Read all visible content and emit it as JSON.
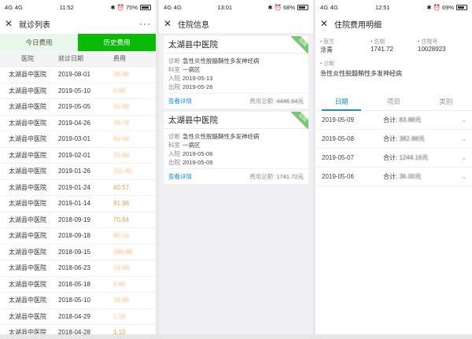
{
  "status_bars": [
    {
      "signal": "4G 4G",
      "time": "11:52",
      "battery": "75%",
      "battery_level": 0.75
    },
    {
      "signal": "4G 4G",
      "time": "13:01",
      "battery": "68%",
      "battery_level": 0.68
    },
    {
      "signal": "4G 4G",
      "time": "12:51",
      "battery": "69%",
      "battery_level": 0.69
    }
  ],
  "panel1": {
    "title": "就诊列表",
    "more": "···",
    "tabs": [
      "今日费用",
      "历史费用"
    ],
    "columns": [
      "医院",
      "就诊日期",
      "费用"
    ],
    "rows": [
      {
        "hospital": "太湖县中医院",
        "date": "2019-08-01",
        "fee": "28.30",
        "blurred": true
      },
      {
        "hospital": "太湖县中医院",
        "date": "2019-05-10",
        "fee": "6.60",
        "blurred": true
      },
      {
        "hospital": "太湖县中医院",
        "date": "2019-05-05",
        "fee": "15.59",
        "blurred": true
      },
      {
        "hospital": "太湖县中医院",
        "date": "2019-04-26",
        "fee": "26.78",
        "blurred": true
      },
      {
        "hospital": "太湖县中医院",
        "date": "2019-03-01",
        "fee": "63.44",
        "blurred": true
      },
      {
        "hospital": "太湖县中医院",
        "date": "2019-02-01",
        "fee": "15.80",
        "blurred": true
      },
      {
        "hospital": "太湖县中医院",
        "date": "2019-01-26",
        "fee": "211.40",
        "blurred": true
      },
      {
        "hospital": "太湖县中医院",
        "date": "2019-01-24",
        "fee": "40.57",
        "blurred": false
      },
      {
        "hospital": "太湖县中医院",
        "date": "2019-01-14",
        "fee": "91.96",
        "blurred": false
      },
      {
        "hospital": "太湖县中医院",
        "date": "2018-09-19",
        "fee": "70.64",
        "blurred": false
      },
      {
        "hospital": "太湖县中医院",
        "date": "2018-09-18",
        "fee": "85.14",
        "blurred": true
      },
      {
        "hospital": "太湖县中医院",
        "date": "2018-09-15",
        "fee": "184.88",
        "blurred": true
      },
      {
        "hospital": "太湖县中医院",
        "date": "2018-06-23",
        "fee": "14.30",
        "blurred": true
      },
      {
        "hospital": "太湖县中医院",
        "date": "2018-05-18",
        "fee": "5.80",
        "blurred": true
      },
      {
        "hospital": "太湖县中医院",
        "date": "2018-05-10",
        "fee": "18.80",
        "blurred": true
      },
      {
        "hospital": "太湖县中医院",
        "date": "2018-04-29",
        "fee": "1.18",
        "blurred": true
      },
      {
        "hospital": "太湖县中医院",
        "date": "2018-04-28",
        "fee": "1.10",
        "blurred": false
      }
    ]
  },
  "panel2": {
    "title": "住院信息",
    "cards": [
      {
        "hospital": "太湖县中医院",
        "ribbon": "出院",
        "diag_label": "诊断",
        "diag": "急性炎性脱髓鞘性多发神经病",
        "dept_label": "科室",
        "dept": "一病区",
        "in_label": "入院",
        "in": "2019-05-13",
        "out_label": "出院",
        "out": "2019-05-26",
        "detail": "查看详情",
        "total_label": "费用总额:",
        "total": "4446.64元"
      },
      {
        "hospital": "太湖县中医院",
        "ribbon": "出院",
        "diag_label": "诊断",
        "diag": "急性炎性脱髓鞘性多发神经病",
        "dept_label": "科室",
        "dept": "一病区",
        "in_label": "入院",
        "in": "2019-05-06",
        "out_label": "出院",
        "out": "2019-05-09",
        "detail": "查看详情",
        "total_label": "费用总额:",
        "total": "1741.72元"
      }
    ]
  },
  "panel3": {
    "title": "住院费用明细",
    "doctor_label": "医生",
    "doctor": "涂青",
    "total_label": "总额",
    "total": "1741.72",
    "inpatient_no_label": "住院号",
    "inpatient_no": "10028923",
    "diag_label": "诊断",
    "diag": "急性炎性脱髓鞘性多发神经病",
    "tabs": [
      "日期",
      "项目",
      "类别"
    ],
    "rows": [
      {
        "date": "2019-05-09",
        "sum_label": "合计:",
        "sum": "83.88元"
      },
      {
        "date": "2019-05-08",
        "sum_label": "合计:",
        "sum": "382.88元"
      },
      {
        "date": "2019-05-07",
        "sum_label": "合计:",
        "sum": "1244.16元"
      },
      {
        "date": "2019-05-06",
        "sum_label": "合计:",
        "sum": "36.00元"
      }
    ]
  },
  "colors": {
    "wechat_green": "#09bb07",
    "fee_orange": "#e8a045",
    "link_blue": "#1a8fd1",
    "ribbon_green": "#7cc576"
  }
}
